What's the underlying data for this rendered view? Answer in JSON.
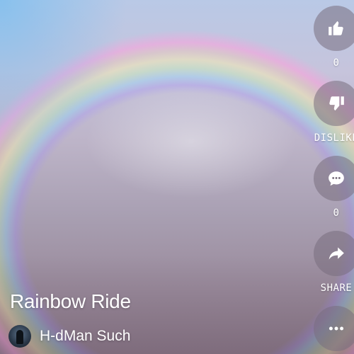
{
  "video": {
    "title": "Rainbow Ride",
    "channel_name": "H-dMan Such"
  },
  "actions": {
    "like": {
      "icon": "thumbs-up-icon",
      "label": "0"
    },
    "dislike": {
      "icon": "thumbs-down-icon",
      "label": "DISLIKE"
    },
    "comments": {
      "icon": "comment-icon",
      "label": "0"
    },
    "share": {
      "icon": "share-arrow-icon",
      "label": "SHARE"
    },
    "more": {
      "icon": "more-dots-icon"
    }
  },
  "colors": {
    "text": "#ffffff",
    "action_button_bg": "#786e7d"
  }
}
